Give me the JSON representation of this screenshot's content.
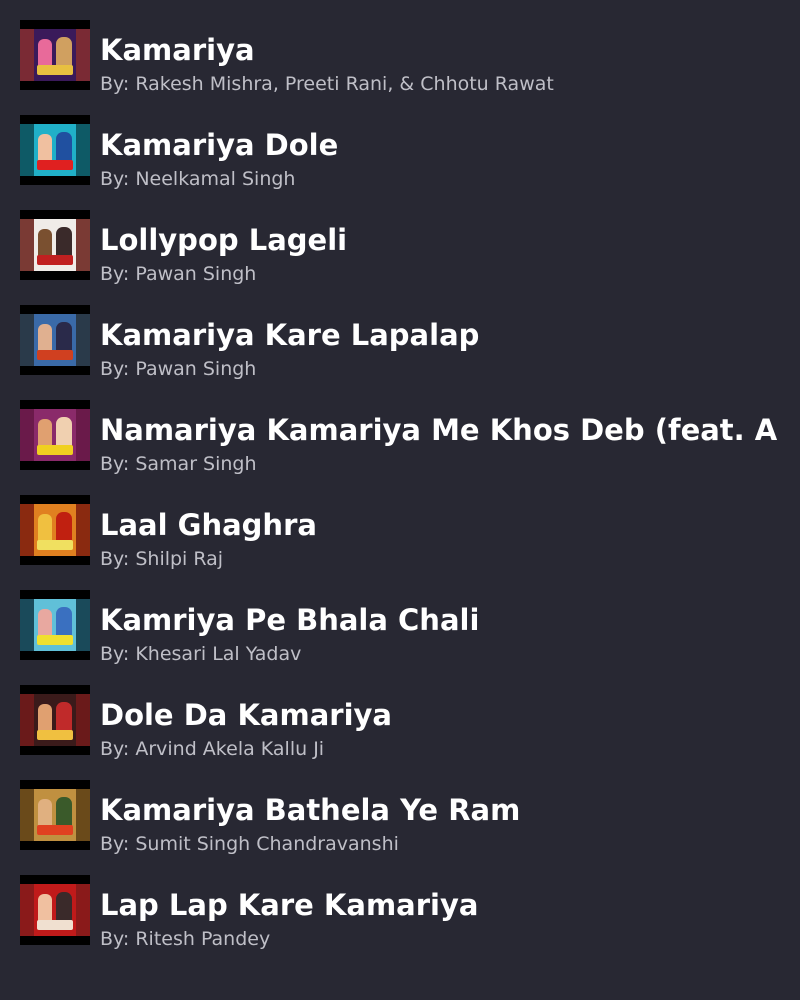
{
  "songs": [
    {
      "title": "Kamariya",
      "artist": "By: Rakesh Mishra, Preeti Rani, & Chhotu Rawat",
      "art_bg": "#7a2a34",
      "poster": [
        "#3a1a5a",
        "#e86a9a",
        "#d0a060",
        "#e8c040"
      ]
    },
    {
      "title": "Kamariya Dole",
      "artist": "By: Neelkamal Singh",
      "art_bg": "#0e5a66",
      "poster": [
        "#20b0c8",
        "#f0c0a0",
        "#2050a0",
        "#e02020"
      ]
    },
    {
      "title": "Lollypop Lageli",
      "artist": "By: Pawan Singh",
      "art_bg": "#7a3a34",
      "poster": [
        "#f0ece8",
        "#7a5030",
        "#3a2a2a",
        "#c02020"
      ]
    },
    {
      "title": "Kamariya Kare Lapalap",
      "artist": "By: Pawan Singh",
      "art_bg": "#2a3a4a",
      "poster": [
        "#3a6aa8",
        "#e0b090",
        "#2a2a4a",
        "#d04020"
      ]
    },
    {
      "title": "Namariya Kamariya Me Khos Deb (feat. A",
      "artist": "By: Samar Singh",
      "art_bg": "#6a1a4a",
      "poster": [
        "#8a2a6a",
        "#e0a070",
        "#f0d0b0",
        "#f0d020"
      ]
    },
    {
      "title": "Laal Ghaghra",
      "artist": "By: Shilpi Raj",
      "art_bg": "#8a2a10",
      "poster": [
        "#e08020",
        "#f0c040",
        "#c02010",
        "#f0e060"
      ]
    },
    {
      "title": "Kamriya Pe Bhala Chali",
      "artist": "By: Khesari Lal Yadav",
      "art_bg": "#1a4a5a",
      "poster": [
        "#60c0d8",
        "#e8a8a0",
        "#3a70c0",
        "#f0e030"
      ]
    },
    {
      "title": "Dole Da Kamariya",
      "artist": "By: Arvind Akela Kallu Ji",
      "art_bg": "#6a1a1a",
      "poster": [
        "#3a1a1a",
        "#e0a070",
        "#c02a2a",
        "#f0c040"
      ]
    },
    {
      "title": "Kamariya Bathela Ye Ram",
      "artist": "By: Sumit Singh Chandravanshi",
      "art_bg": "#6a4a1a",
      "poster": [
        "#c09040",
        "#e0b080",
        "#3a5a2a",
        "#e04020"
      ]
    },
    {
      "title": "Lap Lap Kare Kamariya",
      "artist": "By: Ritesh Pandey",
      "art_bg": "#8a1a1a",
      "poster": [
        "#c01a1a",
        "#f0c0a0",
        "#3a2a2a",
        "#f0e0d0"
      ]
    }
  ]
}
